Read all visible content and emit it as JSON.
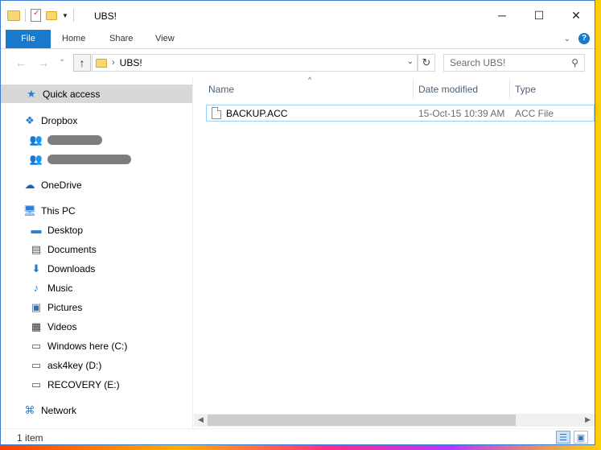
{
  "window": {
    "title": "UBS!",
    "controls": {
      "minimize": "─",
      "maximize": "☐",
      "close": "✕"
    }
  },
  "ribbon": {
    "tabs": [
      "File",
      "Home",
      "Share",
      "View"
    ],
    "expand_icon": "chevron-down-icon",
    "help": "?"
  },
  "navigation": {
    "back": "←",
    "forward": "→",
    "recent": "⌄",
    "up": "↑"
  },
  "address": {
    "crumbs": [
      "UBS!"
    ],
    "separator": "›"
  },
  "search": {
    "placeholder": "Search UBS!"
  },
  "sidebar": {
    "items": [
      {
        "label": "Quick access",
        "icon": "star-icon"
      },
      {
        "label": "Dropbox",
        "icon": "dropbox-icon"
      },
      {
        "label": "",
        "icon": "shared-folder-icon"
      },
      {
        "label": "",
        "icon": "shared-folder-icon"
      },
      {
        "label": "OneDrive",
        "icon": "cloud-icon"
      },
      {
        "label": "This PC",
        "icon": "monitor-icon"
      },
      {
        "label": "Desktop",
        "icon": "desktop-icon"
      },
      {
        "label": "Documents",
        "icon": "document-icon"
      },
      {
        "label": "Downloads",
        "icon": "download-icon"
      },
      {
        "label": "Music",
        "icon": "music-icon"
      },
      {
        "label": "Pictures",
        "icon": "pictures-icon"
      },
      {
        "label": "Videos",
        "icon": "video-icon"
      },
      {
        "label": "Windows here (C:)",
        "icon": "drive-icon"
      },
      {
        "label": "ask4key (D:)",
        "icon": "drive-icon"
      },
      {
        "label": "RECOVERY (E:)",
        "icon": "drive-icon"
      },
      {
        "label": "Network",
        "icon": "network-icon"
      }
    ]
  },
  "files": {
    "columns": [
      "Name",
      "Date modified",
      "Type"
    ],
    "rows": [
      {
        "name": "BACKUP.ACC",
        "date": "15-Oct-15 10:39 AM",
        "type": "ACC File"
      }
    ]
  },
  "status": {
    "text": "1 item"
  },
  "colors": {
    "accent": "#1979ca",
    "selection": "#99d1ff"
  }
}
